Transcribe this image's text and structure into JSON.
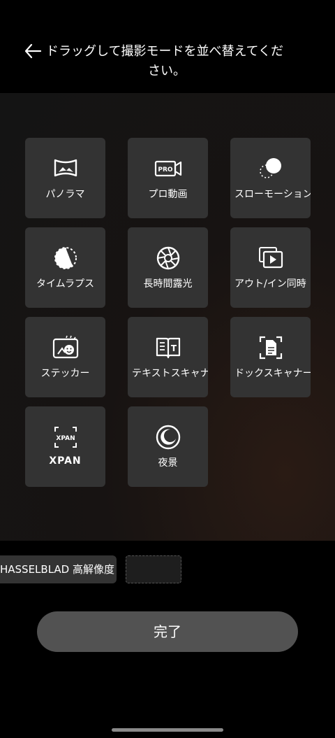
{
  "header": {
    "title_line1": "ドラッグして撮影モードを並べ替えてくだ",
    "title_line2": "さい。"
  },
  "modes": [
    {
      "label": "パノラマ",
      "icon": "panorama-icon"
    },
    {
      "label": "プロ動画",
      "icon": "pro-video-icon",
      "badge": "PRO"
    },
    {
      "label": "スローモーション",
      "icon": "slow-motion-icon"
    },
    {
      "label": "タイムラプス",
      "icon": "time-lapse-icon"
    },
    {
      "label": "長時間露光",
      "icon": "aperture-icon"
    },
    {
      "label": "アウト/イン同時",
      "icon": "dual-view-icon"
    },
    {
      "label": "ステッカー",
      "icon": "sticker-icon"
    },
    {
      "label": "テキストスキャナ",
      "icon": "text-scanner-icon",
      "badge": "T"
    },
    {
      "label": "ドックスキャナー",
      "icon": "document-scanner-icon"
    },
    {
      "label": "XPAN",
      "icon": "xpan-icon",
      "badge": "XPAN"
    },
    {
      "label": "夜景",
      "icon": "night-icon"
    }
  ],
  "bottom_row": {
    "mode_label": "HASSELBLAD 高解像度"
  },
  "done_label": "完了",
  "colors": {
    "tile": "#333333",
    "button": "#525252",
    "status_dot": "#3ad36b"
  }
}
